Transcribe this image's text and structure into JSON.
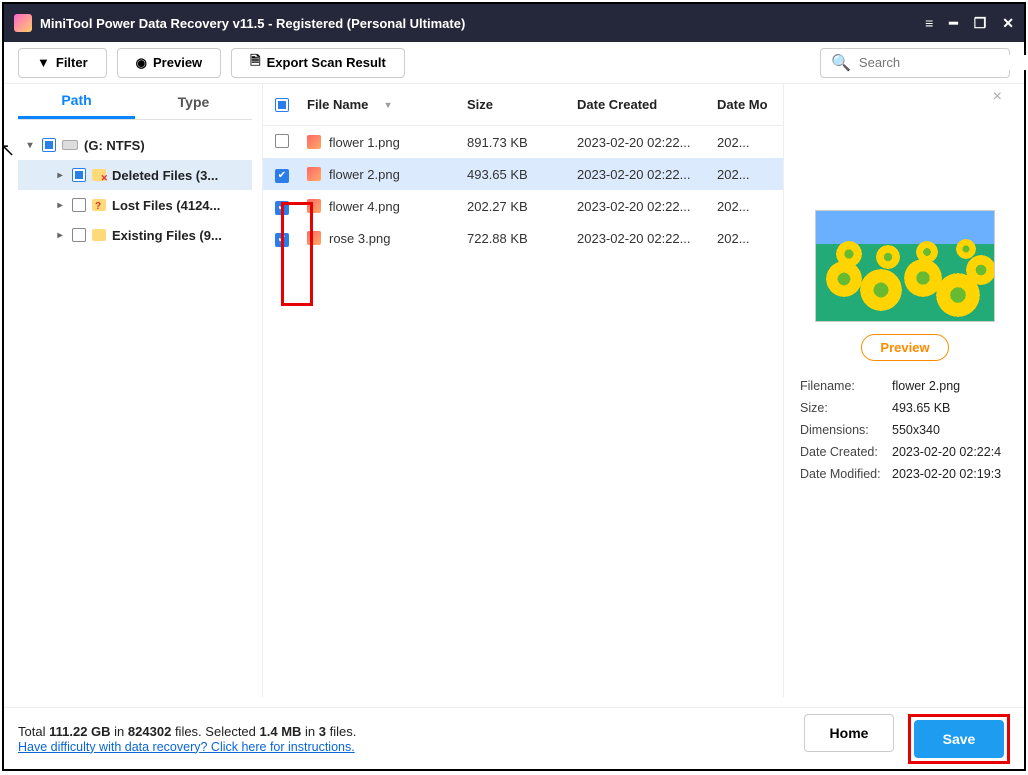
{
  "window": {
    "title": "MiniTool Power Data Recovery v11.5 - Registered (Personal Ultimate)"
  },
  "toolbar": {
    "filter": "Filter",
    "preview": "Preview",
    "export": "Export Scan Result",
    "search_placeholder": "Search"
  },
  "tabs": {
    "path": "Path",
    "type": "Type"
  },
  "tree": {
    "root": "(G: NTFS)",
    "items": [
      {
        "label": "Deleted Files (3..."
      },
      {
        "label": "Lost Files (4124..."
      },
      {
        "label": "Existing Files (9..."
      }
    ]
  },
  "columns": {
    "name": "File Name",
    "size": "Size",
    "created": "Date Created",
    "modified": "Date Mo"
  },
  "files": [
    {
      "checked": false,
      "name": "flower 1.png",
      "size": "891.73 KB",
      "created": "2023-02-20 02:22...",
      "modified": "202..."
    },
    {
      "checked": true,
      "name": "flower 2.png",
      "size": "493.65 KB",
      "created": "2023-02-20 02:22...",
      "modified": "202...",
      "selected": true
    },
    {
      "checked": true,
      "name": "flower 4.png",
      "size": "202.27 KB",
      "created": "2023-02-20 02:22...",
      "modified": "202..."
    },
    {
      "checked": true,
      "name": "rose 3.png",
      "size": "722.88 KB",
      "created": "2023-02-20 02:22...",
      "modified": "202..."
    }
  ],
  "preview": {
    "button": "Preview",
    "labels": {
      "filename": "Filename:",
      "size": "Size:",
      "dimensions": "Dimensions:",
      "created": "Date Created:",
      "modified": "Date Modified:"
    },
    "values": {
      "filename": "flower 2.png",
      "size": "493.65 KB",
      "dimensions": "550x340",
      "created": "2023-02-20 02:22:4",
      "modified": "2023-02-20 02:19:3"
    }
  },
  "footer": {
    "total_label": "Total",
    "total_size": "111.22 GB",
    "in1": "in",
    "total_files": "824302",
    "files_word": "files.",
    "selected_label": "Selected",
    "selected_size": "1.4 MB",
    "in2": "in",
    "selected_count": "3",
    "files_word2": "files.",
    "help_link": "Have difficulty with data recovery? Click here for instructions.",
    "home": "Home",
    "save": "Save"
  }
}
